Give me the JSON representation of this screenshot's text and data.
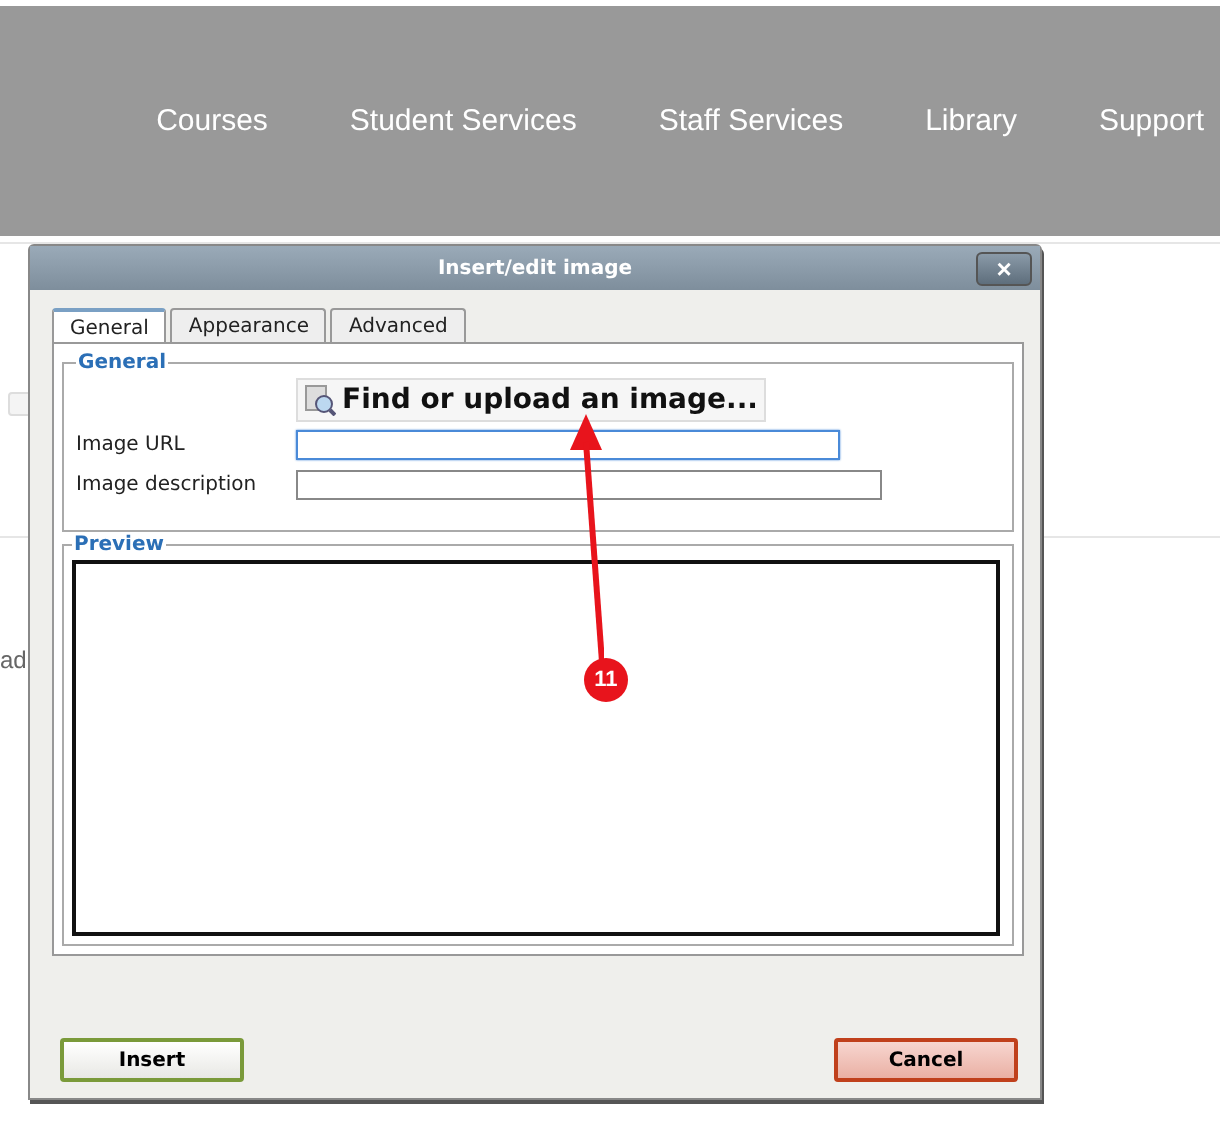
{
  "nav": {
    "items": [
      "Courses",
      "Student Services",
      "Staff Services",
      "Library",
      "Support"
    ]
  },
  "background": {
    "fragment": "ad",
    "checkbox": {
      "checked": false
    }
  },
  "dialog": {
    "title": "Insert/edit image",
    "close": "×",
    "tabs": [
      {
        "label": "General",
        "selected": true
      },
      {
        "label": "Appearance",
        "selected": false
      },
      {
        "label": "Advanced",
        "selected": false
      }
    ],
    "general": {
      "legend": "General",
      "find_button": "Find or upload an image...",
      "fields": [
        {
          "label": "Image URL",
          "focused": true
        },
        {
          "label": "Image description",
          "focused": false
        }
      ]
    },
    "preview": {
      "legend": "Preview"
    },
    "buttons": [
      {
        "label": "Insert",
        "kind": "primary"
      },
      {
        "label": "Cancel",
        "kind": "cancel"
      }
    ]
  },
  "callout": {
    "number": "11"
  }
}
